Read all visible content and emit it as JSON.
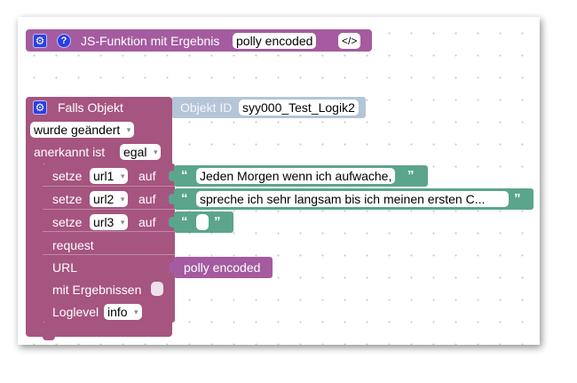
{
  "func_block": {
    "title": "JS-Funktion mit Ergebnis",
    "name_field": "polly encoded",
    "code_button": "</>"
  },
  "trigger_block": {
    "title": "Falls Objekt",
    "object_label": "Objekt ID",
    "object_id": "syy000_Test_Logik2",
    "condition": "wurde geändert",
    "ack_label": "anerkannt ist",
    "ack_value": "egal"
  },
  "call_block": {
    "setze_rows": [
      {
        "label": "setze",
        "var": "url1",
        "auf": "auf",
        "text": "Jeden Morgen wenn ich aufwache,"
      },
      {
        "label": "setze",
        "var": "url2",
        "auf": "auf",
        "text": "spreche ich sehr langsam bis ich meinen ersten C..."
      },
      {
        "label": "setze",
        "var": "url3",
        "auf": "auf",
        "text": ""
      }
    ],
    "request_label": "request",
    "url_label": "URL",
    "url_value": "polly encoded",
    "results_label": "mit Ergebnissen",
    "loglevel_label": "Loglevel",
    "loglevel_value": "info"
  },
  "glyphs": {
    "open_quote": "“",
    "close_quote": "”",
    "dropdown_arrow": "▾",
    "gear": "⚙",
    "help": "?"
  },
  "colors": {
    "func_block": "#a55b9f",
    "trigger_block": "#a5557f",
    "text_block": "#5ba58c",
    "object_block": "#b4c5d8",
    "icon_blue": "#2a3fe0"
  }
}
